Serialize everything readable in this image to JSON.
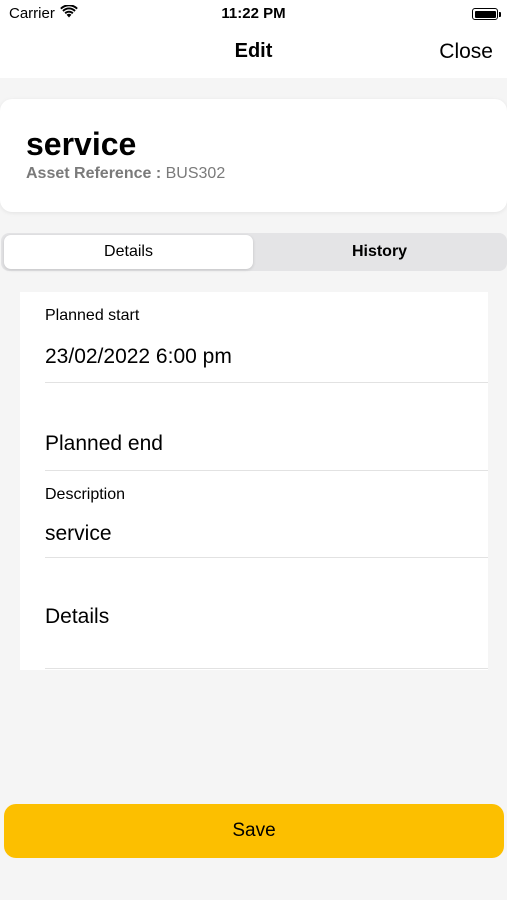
{
  "status_bar": {
    "carrier": "Carrier",
    "time": "11:22 PM",
    "icons": [
      "wifi-icon",
      "battery-icon"
    ]
  },
  "nav": {
    "title": "Edit",
    "close_label": "Close"
  },
  "header": {
    "title": "service",
    "asset_reference_label": "Asset Reference :",
    "asset_reference_value": "BUS302"
  },
  "tabs": [
    {
      "label": "Details",
      "selected": true
    },
    {
      "label": "History",
      "selected": false
    }
  ],
  "form": {
    "planned_start_label": "Planned start",
    "planned_start_value": "23/02/2022 6:00 pm",
    "planned_end_label": "Planned end",
    "description_label": "Description",
    "description_value": "service",
    "details_label": "Details"
  },
  "save_label": "Save",
  "colors": {
    "accent": "#fcbf00",
    "background": "#f5f5f5",
    "secondary_text": "#7a7a7a"
  }
}
